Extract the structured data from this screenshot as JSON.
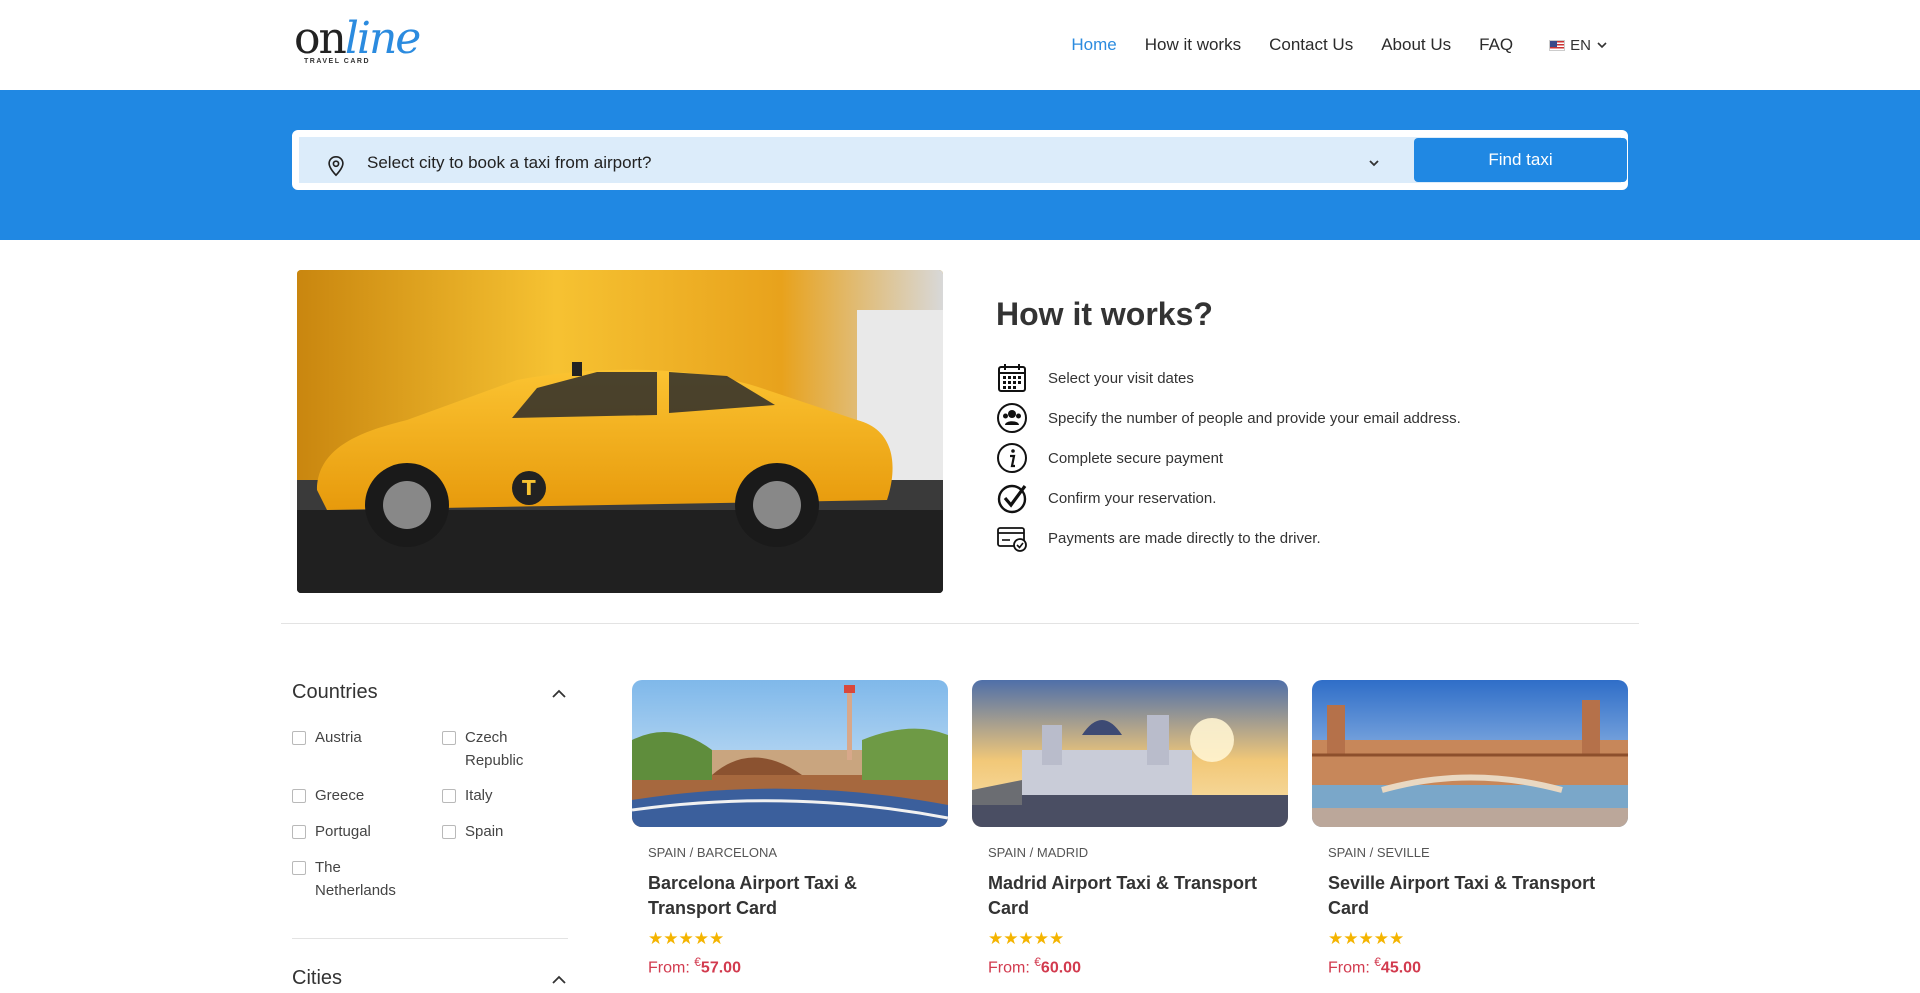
{
  "header": {
    "logo": {
      "on": "on",
      "line": "line",
      "sub": "TRAVEL CARD"
    },
    "nav": [
      {
        "label": "Home",
        "active": true
      },
      {
        "label": "How it works"
      },
      {
        "label": "Contact Us"
      },
      {
        "label": "About Us"
      },
      {
        "label": "FAQ"
      }
    ],
    "language": "EN"
  },
  "search": {
    "placeholder": "Select city to book a taxi from airport?",
    "button": "Find taxi"
  },
  "how_it_works": {
    "title": "How it works?",
    "steps": [
      {
        "icon": "calendar-icon",
        "text": "Select your visit dates"
      },
      {
        "icon": "people-icon",
        "text": "Specify the number of people and provide your email address."
      },
      {
        "icon": "info-icon",
        "text": "Complete secure payment"
      },
      {
        "icon": "check-circle-icon",
        "text": "Confirm your reservation."
      },
      {
        "icon": "card-check-icon",
        "text": "Payments are made directly to the driver."
      }
    ]
  },
  "filters": {
    "countries_title": "Countries",
    "countries": [
      "Austria",
      "Czech Republic",
      "Greece",
      "Italy",
      "Portugal",
      "Spain",
      "The Netherlands"
    ],
    "cities_title": "Cities"
  },
  "cards": [
    {
      "location": "SPAIN / BARCELONA",
      "title": "Barcelona Airport Taxi & Transport Card",
      "stars": "★★★★★",
      "from": "From:",
      "currency": "€",
      "price": "57.00"
    },
    {
      "location": "SPAIN / MADRID",
      "title": "Madrid Airport Taxi & Transport Card",
      "stars": "★★★★★",
      "from": "From:",
      "currency": "€",
      "price": "60.00"
    },
    {
      "location": "SPAIN / SEVILLE",
      "title": "Seville Airport Taxi & Transport Card",
      "stars": "★★★★★",
      "from": "From:",
      "currency": "€",
      "price": "45.00"
    }
  ],
  "colors": {
    "brand_blue": "#2088e3",
    "price_red": "#d23a4e",
    "star_gold": "#f4b400"
  }
}
